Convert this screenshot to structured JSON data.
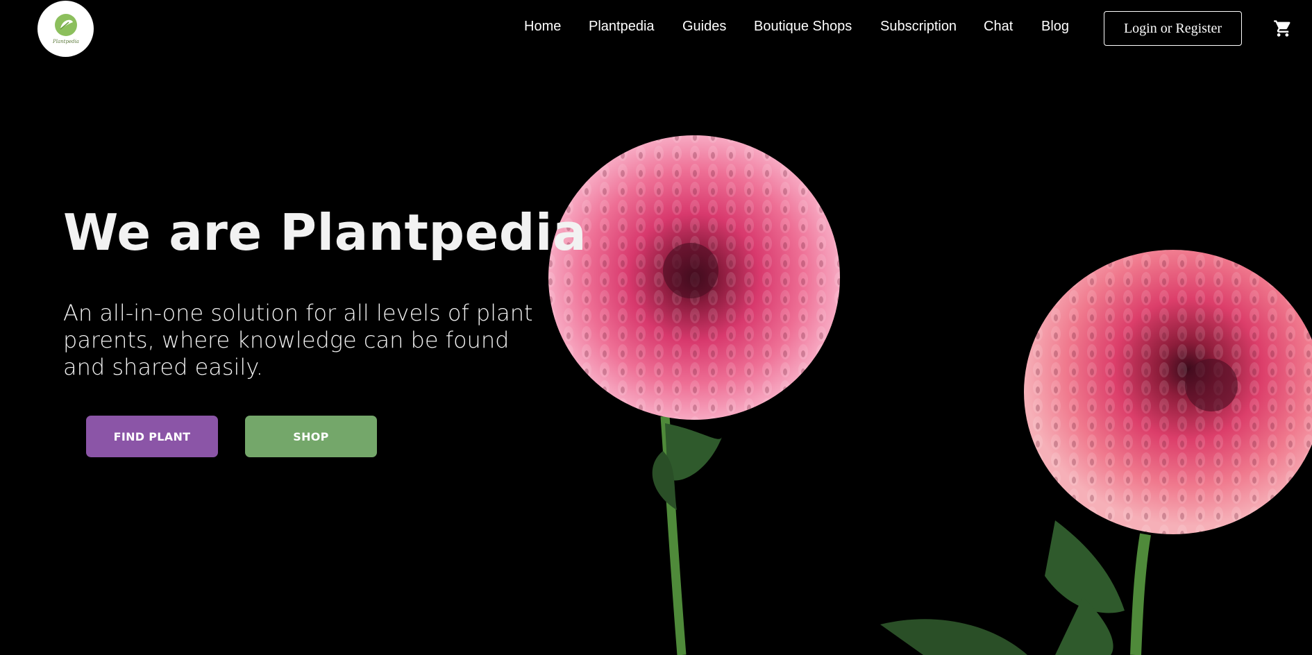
{
  "brand": {
    "logo_text": "Plantpedia",
    "logo_arc_text": "Plantpedia"
  },
  "nav": {
    "items": [
      {
        "label": "Home"
      },
      {
        "label": "Plantpedia"
      },
      {
        "label": "Guides"
      },
      {
        "label": "Boutique Shops"
      },
      {
        "label": "Subscription"
      },
      {
        "label": "Chat"
      },
      {
        "label": "Blog"
      }
    ],
    "login_label": "Login or Register",
    "cart_icon": "cart-icon"
  },
  "hero": {
    "title": "We are Plantpedia",
    "subtitle": "An all-in-one solution for all levels of plant parents, where knowledge can be found and shared easily.",
    "find_plant_label": "FIND PLANT",
    "shop_label": "SHOP"
  },
  "colors": {
    "background": "#000000",
    "find_plant_button": "#8b55a7",
    "shop_button": "#74a76a",
    "text": "#f2f2f2",
    "dahlia_petal": "#e0457a"
  }
}
